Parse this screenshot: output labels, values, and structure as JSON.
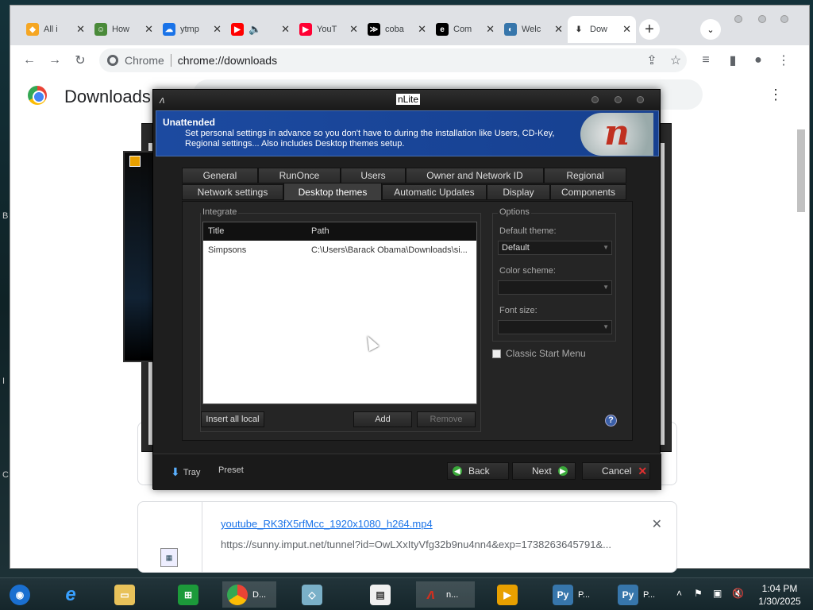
{
  "desktop": {
    "edge_letters": [
      "B",
      "I",
      "C"
    ]
  },
  "chrome": {
    "tabs": [
      {
        "label": "All i",
        "icon": "diamond-icon",
        "color": "#f5a623"
      },
      {
        "label": "How",
        "icon": "people-icon",
        "color": "#4a8a3a"
      },
      {
        "label": "ytmp",
        "icon": "cloud-icon",
        "color": "#1a73e8"
      },
      {
        "label": "",
        "icon": "youtube-icon",
        "color": "#ff0000"
      },
      {
        "label": "YouT",
        "icon": "shorts-icon",
        "color": "#ff0033"
      },
      {
        "label": "coba",
        "icon": "terminal-icon",
        "color": "#000000"
      },
      {
        "label": "Com",
        "icon": "editor-icon",
        "color": "#000000"
      },
      {
        "label": "Welc",
        "icon": "python-icon",
        "color": "#3776ab"
      },
      {
        "label": "Dow",
        "icon": "download-icon",
        "color": "#5f6368"
      }
    ],
    "address": {
      "site_label": "Chrome",
      "url": "chrome://downloads"
    },
    "downloads_title": "Downloads",
    "download_item": {
      "filename": "youtube_RK3fX5rfMcc_1920x1080_h264.mp4",
      "url": "https://sunny.imput.net/tunnel?id=OwLXxItyVfg32b9nu4nn4&exp=1738263645791&..."
    }
  },
  "nlite": {
    "title": "nLite",
    "banner": {
      "heading": "Unattended",
      "description": "Set personal settings in advance so you don't have to during the installation like Users, CD-Key, Regional settings... Also includes Desktop themes setup."
    },
    "tabs_row1": [
      "General",
      "RunOnce",
      "Users",
      "Owner and Network ID",
      "Regional"
    ],
    "tabs_row2": [
      "Network settings",
      "Desktop themes",
      "Automatic Updates",
      "Display",
      "Components"
    ],
    "active_tab": "Desktop themes",
    "integrate": {
      "label": "Integrate",
      "columns": [
        "Title",
        "Path"
      ],
      "rows": [
        {
          "title": "Simpsons",
          "path": "C:\\Users\\Barack Obama\\Downloads\\si..."
        }
      ],
      "buttons": {
        "insert_all": "Insert all local",
        "add": "Add",
        "remove": "Remove"
      }
    },
    "options": {
      "label": "Options",
      "default_theme_label": "Default theme:",
      "default_theme_value": "Default",
      "color_scheme_label": "Color scheme:",
      "color_scheme_value": "",
      "font_size_label": "Font size:",
      "font_size_value": "",
      "classic_start_menu": "Classic Start Menu"
    },
    "bottom": {
      "tray": "Tray",
      "preset": "Preset",
      "back": "Back",
      "next": "Next",
      "cancel": "Cancel"
    }
  },
  "taskbar": {
    "items": [
      {
        "label": "",
        "icon": "media-center-icon"
      },
      {
        "label": "",
        "icon": "internet-explorer-icon"
      },
      {
        "label": "",
        "icon": "file-explorer-icon"
      },
      {
        "label": "",
        "icon": "store-icon"
      },
      {
        "label": "D...",
        "icon": "chrome-icon"
      },
      {
        "label": "",
        "icon": "app-icon"
      },
      {
        "label": "",
        "icon": "notepad-icon"
      },
      {
        "label": "n...",
        "icon": "nlite-icon"
      },
      {
        "label": "",
        "icon": "vlc-icon"
      },
      {
        "label": "P...",
        "icon": "python-icon"
      },
      {
        "label": "P...",
        "icon": "python-icon"
      }
    ],
    "time": "1:04 PM",
    "date": "1/30/2025"
  }
}
